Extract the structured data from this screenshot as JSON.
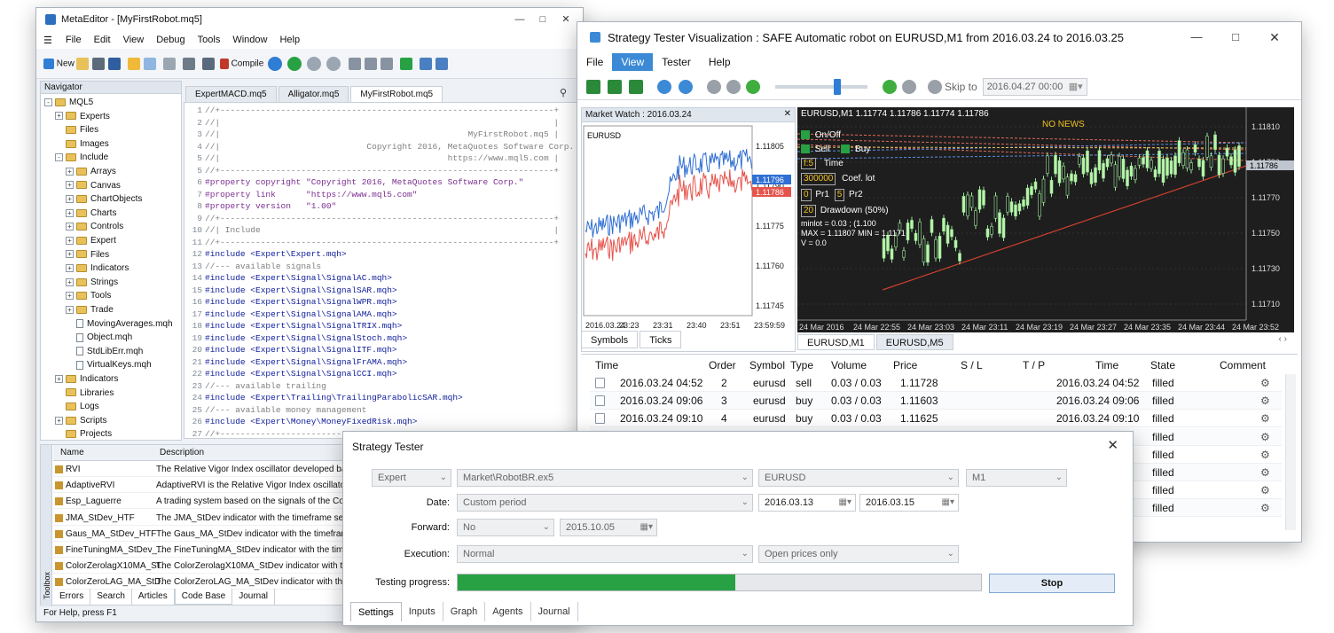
{
  "metaeditor": {
    "title": "MetaEditor - [MyFirstRobot.mq5]",
    "menu": [
      "File",
      "Edit",
      "View",
      "Debug",
      "Tools",
      "Window",
      "Help"
    ],
    "toolbar": {
      "new_label": "New",
      "compile_label": "Compile"
    },
    "navigator": {
      "header": "Navigator",
      "items": [
        {
          "label": "MQL5",
          "level": 0,
          "kind": "folder",
          "tw": "-"
        },
        {
          "label": "Experts",
          "level": 1,
          "kind": "folder",
          "tw": "+"
        },
        {
          "label": "Files",
          "level": 1,
          "kind": "folder",
          "tw": ""
        },
        {
          "label": "Images",
          "level": 1,
          "kind": "folder",
          "tw": ""
        },
        {
          "label": "Include",
          "level": 1,
          "kind": "folder",
          "tw": "-"
        },
        {
          "label": "Arrays",
          "level": 2,
          "kind": "folder",
          "tw": "+"
        },
        {
          "label": "Canvas",
          "level": 2,
          "kind": "folder",
          "tw": "+"
        },
        {
          "label": "ChartObjects",
          "level": 2,
          "kind": "folder",
          "tw": "+"
        },
        {
          "label": "Charts",
          "level": 2,
          "kind": "folder",
          "tw": "+"
        },
        {
          "label": "Controls",
          "level": 2,
          "kind": "folder",
          "tw": "+"
        },
        {
          "label": "Expert",
          "level": 2,
          "kind": "folder",
          "tw": "+"
        },
        {
          "label": "Files",
          "level": 2,
          "kind": "folder",
          "tw": "+"
        },
        {
          "label": "Indicators",
          "level": 2,
          "kind": "folder",
          "tw": "+"
        },
        {
          "label": "Strings",
          "level": 2,
          "kind": "folder",
          "tw": "+"
        },
        {
          "label": "Tools",
          "level": 2,
          "kind": "folder",
          "tw": "+"
        },
        {
          "label": "Trade",
          "level": 2,
          "kind": "folder",
          "tw": "+"
        },
        {
          "label": "MovingAverages.mqh",
          "level": 2,
          "kind": "file",
          "tw": ""
        },
        {
          "label": "Object.mqh",
          "level": 2,
          "kind": "file",
          "tw": ""
        },
        {
          "label": "StdLibErr.mqh",
          "level": 2,
          "kind": "file",
          "tw": ""
        },
        {
          "label": "VirtualKeys.mqh",
          "level": 2,
          "kind": "file",
          "tw": ""
        },
        {
          "label": "Indicators",
          "level": 1,
          "kind": "folder",
          "tw": "+"
        },
        {
          "label": "Libraries",
          "level": 1,
          "kind": "folder",
          "tw": ""
        },
        {
          "label": "Logs",
          "level": 1,
          "kind": "folder",
          "tw": ""
        },
        {
          "label": "Scripts",
          "level": 1,
          "kind": "folder",
          "tw": "+"
        },
        {
          "label": "Projects",
          "level": 1,
          "kind": "folder",
          "tw": ""
        }
      ]
    },
    "tabs": [
      "ExpertMACD.mq5",
      "Alligator.mq5",
      "MyFirstRobot.mq5"
    ],
    "code": [
      {
        "n": "1",
        "t": "//+------------------------------------------------------------------+",
        "c": "c-com"
      },
      {
        "n": "2",
        "t": "//|                                                                  |",
        "c": "c-com"
      },
      {
        "n": "3",
        "t": "//|                                                 MyFirstRobot.mq5 |",
        "c": "c-com"
      },
      {
        "n": "4",
        "t": "//|                             Copyright 2016, MetaQuotes Software Corp. |",
        "c": "c-com"
      },
      {
        "n": "5",
        "t": "//|                                             https://www.mql5.com |",
        "c": "c-com"
      },
      {
        "n": "5",
        "t": "//+------------------------------------------------------------------+",
        "c": "c-com"
      },
      {
        "n": "6",
        "t": "#property copyright \"Copyright 2016, MetaQuotes Software Corp.\"",
        "c": "c-dir"
      },
      {
        "n": "7",
        "t": "#property link      \"https://www.mql5.com\"",
        "c": "c-dir"
      },
      {
        "n": "8",
        "t": "#property version   \"1.00\"",
        "c": "c-dir"
      },
      {
        "n": "9",
        "t": "//+------------------------------------------------------------------+",
        "c": "c-com"
      },
      {
        "n": "10",
        "t": "//| Include                                                          |",
        "c": "c-com"
      },
      {
        "n": "11",
        "t": "//+------------------------------------------------------------------+",
        "c": "c-com"
      },
      {
        "n": "12",
        "t": "#include <Expert\\Expert.mqh>",
        "c": "c-inc"
      },
      {
        "n": "13",
        "t": "//--- available signals",
        "c": "c-com"
      },
      {
        "n": "14",
        "t": "#include <Expert\\Signal\\SignalAC.mqh>",
        "c": "c-inc"
      },
      {
        "n": "15",
        "t": "#include <Expert\\Signal\\SignalSAR.mqh>",
        "c": "c-inc"
      },
      {
        "n": "16",
        "t": "#include <Expert\\Signal\\SignalWPR.mqh>",
        "c": "c-inc"
      },
      {
        "n": "17",
        "t": "#include <Expert\\Signal\\SignalAMA.mqh>",
        "c": "c-inc"
      },
      {
        "n": "18",
        "t": "#include <Expert\\Signal\\SignalTRIX.mqh>",
        "c": "c-inc"
      },
      {
        "n": "19",
        "t": "#include <Expert\\Signal\\SignalStoch.mqh>",
        "c": "c-inc"
      },
      {
        "n": "20",
        "t": "#include <Expert\\Signal\\SignalITF.mqh>",
        "c": "c-inc"
      },
      {
        "n": "21",
        "t": "#include <Expert\\Signal\\SignalFrAMA.mqh>",
        "c": "c-inc"
      },
      {
        "n": "22",
        "t": "#include <Expert\\Signal\\SignalCCI.mqh>",
        "c": "c-inc"
      },
      {
        "n": "23",
        "t": "//--- available trailing",
        "c": "c-com"
      },
      {
        "n": "24",
        "t": "#include <Expert\\Trailing\\TrailingParabolicSAR.mqh>",
        "c": "c-inc"
      },
      {
        "n": "25",
        "t": "//--- available money management",
        "c": "c-com"
      },
      {
        "n": "26",
        "t": "#include <Expert\\Money\\MoneyFixedRisk.mqh>",
        "c": "c-inc"
      },
      {
        "n": "27",
        "t": "//+------------------------------------------------------------------+",
        "c": "c-com"
      }
    ],
    "toolbox": {
      "side_label": "Toolbox",
      "col_name": "Name",
      "col_desc": "Description",
      "rows": [
        {
          "name": "RVI",
          "desc": "The Relative Vigor Index oscillator developed based on the a"
        },
        {
          "name": "AdaptiveRVI",
          "desc": "AdaptiveRVI is the Relative Vigor Index oscillator that adapts"
        },
        {
          "name": "Esp_Laguerre",
          "desc": "A trading system based on the signals of the ColorLaguerre"
        },
        {
          "name": "JMA_StDev_HTF",
          "desc": "The JMA_StDev indicator with the timeframe selection optio"
        },
        {
          "name": "Gaus_MA_StDev_HTF",
          "desc": "The Gaus_MA_StDev indicator with the timeframe selection"
        },
        {
          "name": "FineTuningMA_StDev_...",
          "desc": "The FineTuningMA_StDev indicator with the timeframe sele"
        },
        {
          "name": "ColorZerolagX10MA_St...",
          "desc": "The ColorZerolagX10MA_StDev indicator with the timefram"
        },
        {
          "name": "ColorZeroLAG_MA_StD...",
          "desc": "The ColorZeroLAG_MA_StDev indicator with the timeframe"
        }
      ],
      "tabs": [
        "Errors",
        "Search",
        "Articles",
        "Code Base",
        "Journal"
      ]
    },
    "status": "For Help, press F1"
  },
  "visualization": {
    "title": "Strategy Tester Visualization : SAFE Automatic robot on EURUSD,M1 from 2016.03.24 to 2016.03.25",
    "menu": [
      "File",
      "View",
      "Tester",
      "Help"
    ],
    "skip_label": "Skip to",
    "skip_date": "2016.04.27 00:00",
    "market_watch": {
      "header": "Market Watch : 2016.03.24",
      "symbol": "EURUSD",
      "y_ticks": [
        "1.11805",
        "1.11790",
        "1.11775",
        "1.11760",
        "1.11745"
      ],
      "bid": "1.11796",
      "ask": "1.11786",
      "x_ticks": [
        "2016.03.24",
        "23:23",
        "23:31",
        "23:40",
        "23:51",
        "23:59:59"
      ],
      "tabs": [
        "Symbols",
        "Ticks"
      ]
    },
    "chart": {
      "header": "EURUSD,M1  1.11774 1.11786 1.11774 1.11786",
      "news": "NO  NEWS",
      "y_ticks": [
        "1.11810",
        "1.11790",
        "1.11770",
        "1.11750",
        "1.11730",
        "1.11710"
      ],
      "x_ticks": [
        "24 Mar 2016",
        "24 Mar 22:55",
        "24 Mar 23:03",
        "24 Mar 23:11",
        "24 Mar 23:19",
        "24 Mar 23:27",
        "24 Mar 23:35",
        "24 Mar 23:44",
        "24 Mar 23:52"
      ],
      "last_price": "1.11786",
      "panel": {
        "onoff": "On/Off",
        "sell": "Sell",
        "buy": "Buy",
        "f_label": "f:5",
        "time_label": "Time",
        "lot_val": "300000",
        "lot_label": "Coef. lot",
        "pr1_val": "0",
        "pr1_label": "Pr1",
        "pr2_val": "5",
        "pr2_label": "Pr2",
        "dd_val": "20",
        "dd_label": "Drawdown",
        "dd_pct": "(50%)",
        "stat1": "minlot = 0.03 ;  (1.100",
        "stat2": "MAX = 1.11807   MIN = 1.1171",
        "stat3": "V = 0.0"
      },
      "tabs": [
        "EURUSD,M1",
        "EURUSD,M5"
      ]
    },
    "orders": {
      "headers": [
        "Time",
        "Order",
        "Symbol",
        "Type",
        "Volume",
        "Price",
        "S / L",
        "T / P",
        "Time",
        "State",
        "Comment"
      ],
      "rows": [
        {
          "time": "2016.03.24 04:52",
          "order": "2",
          "symbol": "eurusd",
          "type": "sell",
          "volume": "0.03 / 0.03",
          "price": "1.11728",
          "sl": "",
          "tp": "",
          "time2": "2016.03.24 04:52",
          "state": "filled"
        },
        {
          "time": "2016.03.24 09:06",
          "order": "3",
          "symbol": "eurusd",
          "type": "buy",
          "volume": "0.03 / 0.03",
          "price": "1.11603",
          "sl": "",
          "tp": "",
          "time2": "2016.03.24 09:06",
          "state": "filled"
        },
        {
          "time": "2016.03.24 09:10",
          "order": "4",
          "symbol": "eurusd",
          "type": "buy",
          "volume": "0.03 / 0.03",
          "price": "1.11625",
          "sl": "",
          "tp": "",
          "time2": "2016.03.24 09:10",
          "state": "filled"
        },
        {
          "state": "filled"
        },
        {
          "state": "filled"
        },
        {
          "state": "filled"
        },
        {
          "state": "filled"
        },
        {
          "state": "filled"
        }
      ]
    }
  },
  "tester": {
    "title": "Strategy Tester",
    "expert_mode": "Expert",
    "expert_file": "Market\\RobotBR.ex5",
    "symbol": "EURUSD",
    "timeframe": "M1",
    "date_label": "Date:",
    "date_mode": "Custom period",
    "date_from": "2016.03.13",
    "date_to": "2016.03.15",
    "forward_label": "Forward:",
    "forward_mode": "No",
    "forward_date": "2015.10.05",
    "exec_label": "Execution:",
    "exec_mode": "Normal",
    "model": "Open prices only",
    "progress_label": "Testing progress:",
    "progress": 0.53,
    "stop_label": "Stop",
    "tabs": [
      "Settings",
      "Inputs",
      "Graph",
      "Agents",
      "Journal"
    ]
  }
}
